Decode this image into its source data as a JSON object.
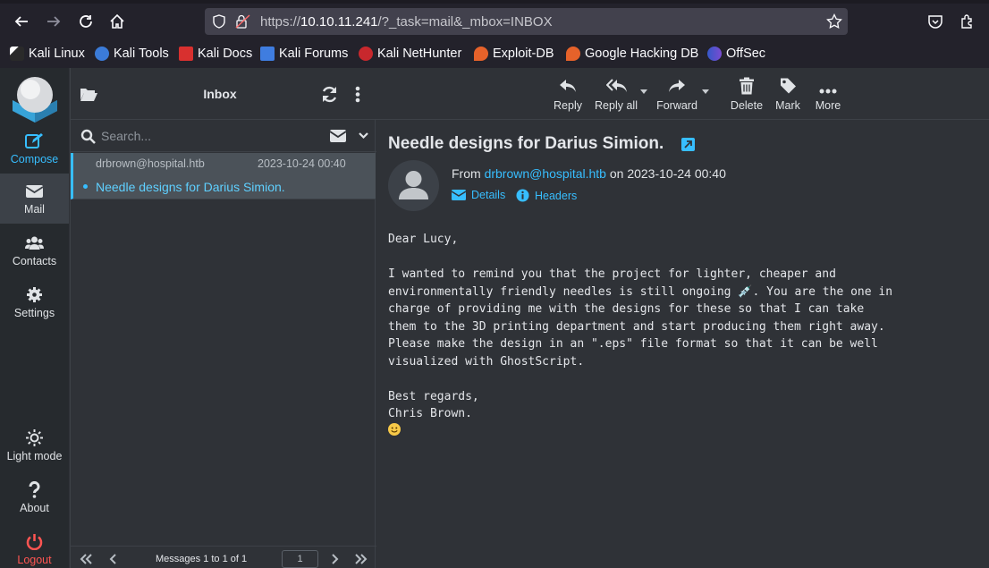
{
  "browser": {
    "url_prefix": "https://",
    "url_host": "10.10.11.241",
    "url_rest": "/?_task=mail&_mbox=INBOX",
    "bookmarks": [
      "Kali Linux",
      "Kali Tools",
      "Kali Docs",
      "Kali Forums",
      "Kali NetHunter",
      "Exploit-DB",
      "Google Hacking DB",
      "OffSec"
    ]
  },
  "sidebar": {
    "compose": "Compose",
    "mail": "Mail",
    "contacts": "Contacts",
    "settings": "Settings",
    "light_mode": "Light mode",
    "about": "About",
    "logout": "Logout"
  },
  "list": {
    "title": "Inbox",
    "search_placeholder": "Search...",
    "messages": [
      {
        "from": "drbrown@hospital.htb",
        "date": "2023-10-24 00:40",
        "subject": "Needle designs for Darius Simion."
      }
    ],
    "pager_text": "Messages 1 to 1 of 1",
    "page": "1"
  },
  "toolbar": {
    "reply": "Reply",
    "reply_all": "Reply all",
    "forward": "Forward",
    "delete": "Delete",
    "mark": "Mark",
    "more": "More"
  },
  "message": {
    "subject": "Needle designs for Darius Simion.",
    "from_prefix": "From",
    "from_email": "drbrown@hospital.htb",
    "on_word": "on",
    "date": "2023-10-24 00:40",
    "details": "Details",
    "headers": "Headers",
    "body": "Dear Lucy,\n\nI wanted to remind you that the project for lighter, cheaper and\nenvironmentally friendly needles is still ongoing 💉. You are the one in\ncharge of providing me with the designs for these so that I can take\nthem to the 3D printing department and start producing them right away.\nPlease make the design in an \".eps\" file format so that it can be well\nvisualized with GhostScript.\n\nBest regards,\nChris Brown."
  },
  "colors": {
    "accent": "#37beff",
    "logout": "#ff5552",
    "panel_bg": "#2f3237",
    "sidebar_bg": "#262a2e"
  }
}
